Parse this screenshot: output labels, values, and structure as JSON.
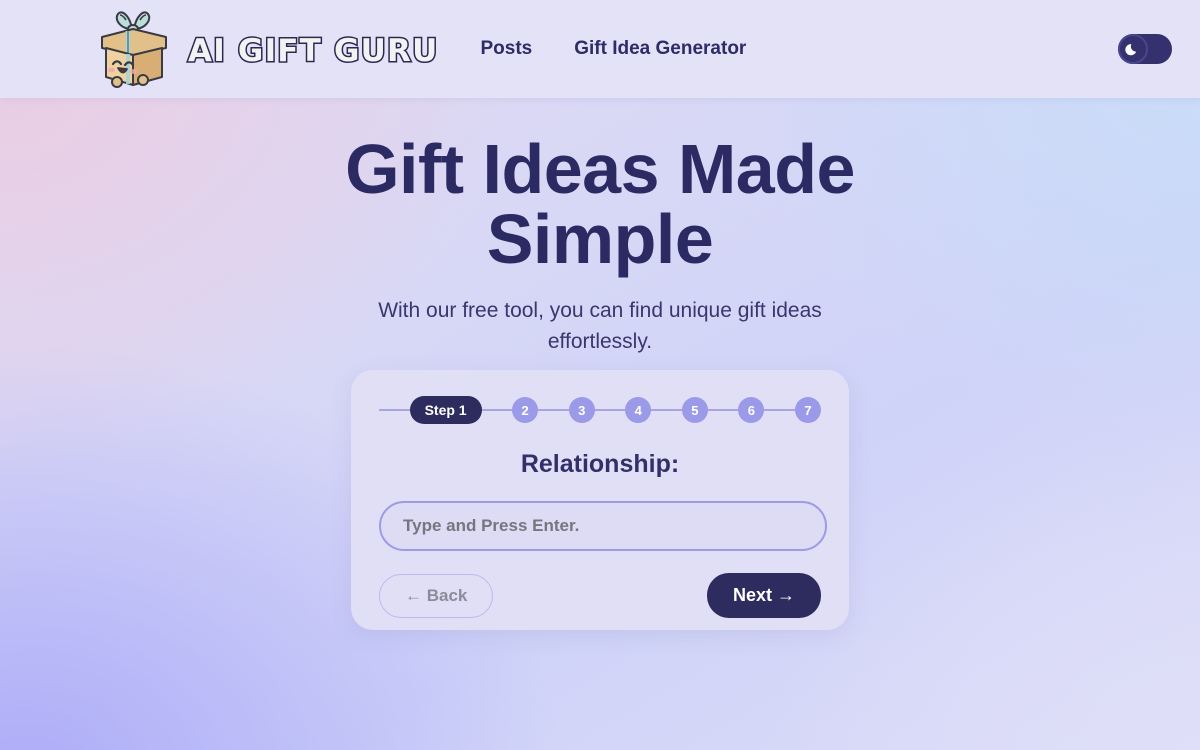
{
  "header": {
    "logo_icon": "gift-box-mascot-icon",
    "brand_name": "AI GIFT GURU",
    "nav": [
      {
        "label": "Posts"
      },
      {
        "label": "Gift Idea Generator"
      }
    ],
    "theme_toggle": {
      "icon": "crescent-moon-icon",
      "state": "off"
    }
  },
  "hero": {
    "title": "Gift Ideas Made Simple",
    "subtitle": "With our free tool, you can find unique gift ideas effortlessly."
  },
  "wizard": {
    "current_step_label": "Step 1",
    "upcoming_steps": [
      "2",
      "3",
      "4",
      "5",
      "6",
      "7"
    ],
    "question": "Relationship:",
    "input_value": "",
    "input_placeholder": "Type and Press Enter.",
    "back_label": "← Back",
    "next_label": "Next →"
  },
  "colors": {
    "ink": "#2b2a63",
    "accent_dark": "#2e2b5e",
    "accent_purple": "#9b9ae8",
    "card_bg": "#e0dff5",
    "header_bg": "#e3e2f6"
  }
}
